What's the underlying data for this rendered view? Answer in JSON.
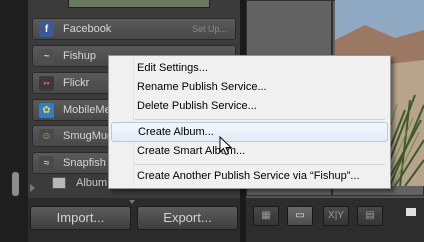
{
  "services": [
    {
      "name": "Facebook",
      "status": "Set Up...",
      "icon": "facebook-icon",
      "color": "#3b5998",
      "glyph": "f"
    },
    {
      "name": "Fishup",
      "status": "",
      "icon": "fishup-icon",
      "color": "#5a5a5a",
      "glyph": "~"
    },
    {
      "name": "Flickr",
      "status": "",
      "icon": "flickr-icon",
      "color": "#c0257e",
      "glyph": "••"
    },
    {
      "name": "MobileMe",
      "status": "",
      "icon": "mobileme-icon",
      "color": "#2f7dcf",
      "glyph": "✿"
    },
    {
      "name": "SmugMug",
      "status": "",
      "icon": "smugmug-icon",
      "color": "#8ab62f",
      "glyph": "☺"
    },
    {
      "name": "Snapfish",
      "status": "",
      "icon": "snapfish-icon",
      "color": "#6b6b6b",
      "glyph": "≈"
    }
  ],
  "album_label": "Album",
  "buttons": {
    "import": "Import...",
    "export": "Export..."
  },
  "toolbar": {
    "grid": "▦",
    "loupe": "▭",
    "compare": "X|Y",
    "survey": "▤"
  },
  "context_menu": {
    "items": [
      "Edit Settings...",
      "Rename Publish Service...",
      "Delete Publish Service...",
      "Create Album...",
      "Create Smart Album...",
      "Create Another Publish Service via “Fishup”..."
    ],
    "highlighted": "Create Album..."
  },
  "colors": {
    "menu_highlight": "#aecbea",
    "panel": "#3b3b3b"
  }
}
